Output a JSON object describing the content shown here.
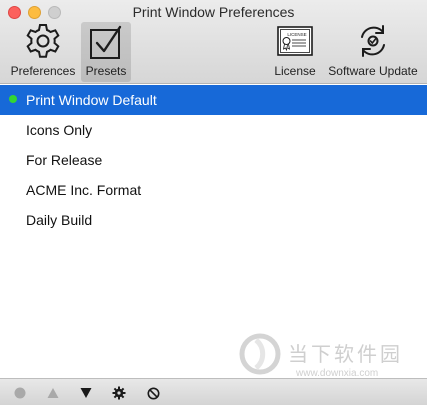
{
  "window": {
    "title": "Print Window Preferences"
  },
  "toolbar": {
    "preferences_label": "Preferences",
    "presets_label": "Presets",
    "license_label": "License",
    "software_update_label": "Software Update",
    "selected": "presets"
  },
  "presets": [
    {
      "label": "Print Window Default",
      "selected": true,
      "default": true
    },
    {
      "label": "Icons Only",
      "selected": false,
      "default": false
    },
    {
      "label": "For Release",
      "selected": false,
      "default": false
    },
    {
      "label": "ACME Inc. Format",
      "selected": false,
      "default": false
    },
    {
      "label": "Daily Build",
      "selected": false,
      "default": false
    }
  ],
  "license_badge_text": "LICENSE",
  "watermark": {
    "text_cn": "当下软件园",
    "url": "www.downxia.com"
  },
  "bottom_bar": {
    "buttons": [
      "add-circle-icon",
      "move-up-icon",
      "move-down-icon",
      "gear-icon",
      "prohibited-icon"
    ]
  },
  "colors": {
    "selection": "#1769d8",
    "default_dot": "#33d633"
  }
}
